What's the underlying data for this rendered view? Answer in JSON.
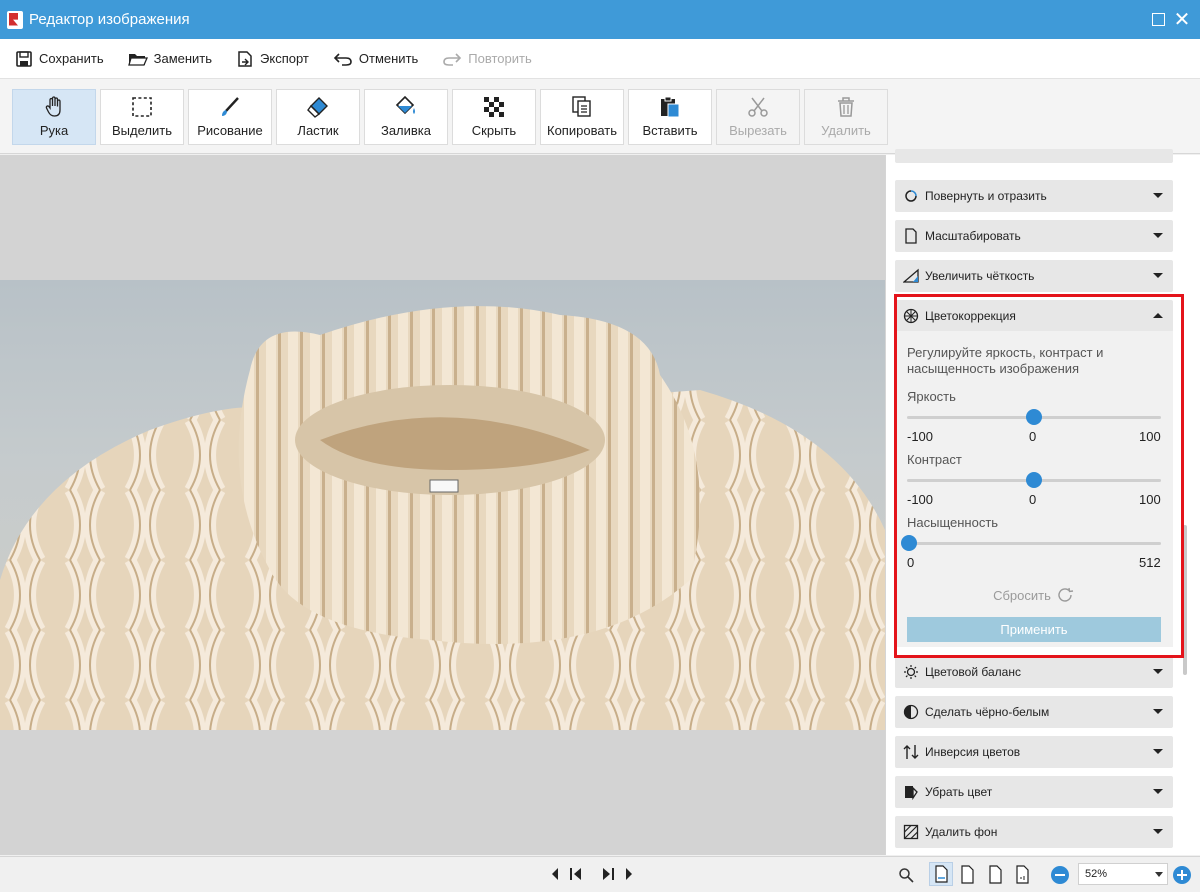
{
  "window": {
    "title": "Редактор изображения"
  },
  "menu": {
    "save": "Сохранить",
    "replace": "Заменить",
    "export": "Экспорт",
    "undo": "Отменить",
    "redo": "Повторить"
  },
  "tools": {
    "hand": "Рука",
    "select": "Выделить",
    "draw": "Рисование",
    "eraser": "Ластик",
    "fill": "Заливка",
    "hide": "Скрыть",
    "copy": "Копировать",
    "paste": "Вставить",
    "cut": "Вырезать",
    "delete": "Удалить"
  },
  "panel": {
    "sections": {
      "rotate": "Повернуть и отразить",
      "scale": "Масштабировать",
      "sharpen": "Увеличить чёткость",
      "color_correction": "Цветокоррекция",
      "color_balance": "Цветовой баланс",
      "black_white": "Сделать чёрно-белым",
      "invert": "Инверсия цветов",
      "remove_color": "Убрать цвет",
      "remove_bg": "Удалить фон"
    },
    "color_correction": {
      "description": "Регулируйте яркость, контраст и насыщенность изображения",
      "brightness": {
        "label": "Яркость",
        "min": "-100",
        "mid": "0",
        "max": "100",
        "value": 0
      },
      "contrast": {
        "label": "Контраст",
        "min": "-100",
        "mid": "0",
        "max": "100",
        "value": 0
      },
      "saturation": {
        "label": "Насыщенность",
        "min": "0",
        "max": "512",
        "value": 0
      },
      "reset": "Сбросить",
      "apply": "Применить"
    }
  },
  "status": {
    "zoom": "52%"
  },
  "colors": {
    "accent": "#3f9ad8",
    "highlight": "#e4141b",
    "slider": "#2e8ad4",
    "apply": "#9ec9dd"
  }
}
